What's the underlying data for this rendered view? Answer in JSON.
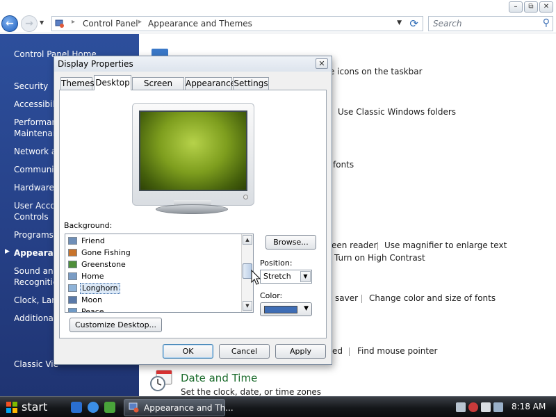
{
  "explorer": {
    "breadcrumb": [
      "Control Panel",
      "Appearance and Themes"
    ],
    "search_placeholder": "Search",
    "window_buttons": {
      "minimize": "–",
      "restore": "⧉",
      "close": "✕"
    }
  },
  "left_pane": {
    "items": [
      {
        "label": "Control Panel Home"
      },
      {
        "label": "Security"
      },
      {
        "label": "Accessibili"
      },
      {
        "label": "Performan"
      },
      {
        "label": "Maintenar"
      },
      {
        "label": "Network a"
      },
      {
        "label": "Communi"
      },
      {
        "label": "Hardware"
      },
      {
        "label": "User Acco"
      },
      {
        "label": "Controls"
      },
      {
        "label": "Programs"
      },
      {
        "label": "Appearanc"
      },
      {
        "label": "Sound and"
      },
      {
        "label": "Recognitic"
      },
      {
        "label": "Clock, Lan"
      },
      {
        "label": "Additional"
      },
      {
        "label": "Classic Vie"
      }
    ]
  },
  "content": {
    "taskbar_icons_link": "e icons on the taskbar",
    "classic_folders_link": "Use Classic Windows folders",
    "fonts_link": "fonts",
    "screen_reader_link": "een reader",
    "magnifier_link": "Use magnifier to enlarge text",
    "high_contrast_link": "Turn on High Contrast",
    "saver_link": "saver",
    "color_size_fonts_link": "Change color and size of fonts",
    "ed_fragment": "ed",
    "mouse_pointer_link": "Find mouse pointer",
    "date_time_title": "Date and Time",
    "date_time_sub": "Set the clock, date, or time zones"
  },
  "dialog": {
    "title": "Display Properties",
    "close": "✕",
    "tabs": [
      "Themes",
      "Desktop",
      "Screen Saver",
      "Appearance",
      "Settings"
    ],
    "active_tab": "Desktop",
    "background_label": "Background:",
    "backgrounds": [
      {
        "name": "Friend",
        "thumb": "#6f8fb8"
      },
      {
        "name": "Gone Fishing",
        "thumb": "#c8742c"
      },
      {
        "name": "Greenstone",
        "thumb": "#4f8f3a"
      },
      {
        "name": "Home",
        "thumb": "#7a9cc4"
      },
      {
        "name": "Longhorn",
        "thumb": "#8fb3d8"
      },
      {
        "name": "Moon",
        "thumb": "#5a79a8"
      },
      {
        "name": "Peace",
        "thumb": "#6f9ac6"
      }
    ],
    "selected_background": "Longhorn",
    "browse": "Browse...",
    "position_label": "Position:",
    "position_value": "Stretch",
    "color_label": "Color:",
    "color_value": "#3e6db5",
    "customize": "Customize Desktop...",
    "ok": "OK",
    "cancel": "Cancel",
    "apply": "Apply"
  },
  "taskbar": {
    "start": "start",
    "task_label": "Appearance and Th...",
    "clock": "8:18 AM"
  }
}
